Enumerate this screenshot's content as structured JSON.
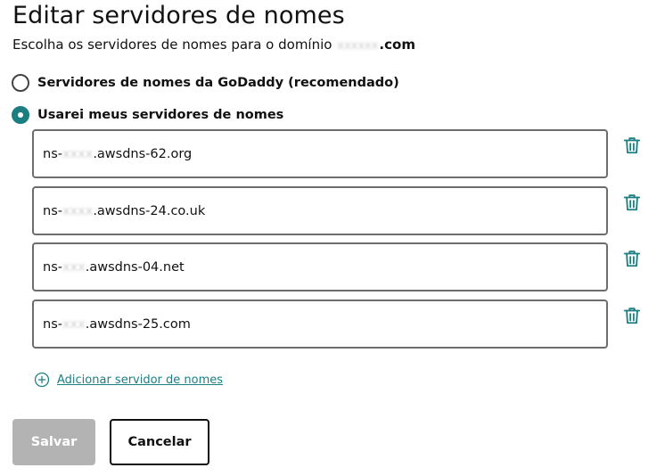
{
  "page": {
    "title": "Editar servidores de nomes",
    "subtitle_prefix": "Escolha os servidores de nomes para o domínio",
    "domain_masked": "xxxxxx",
    "domain_tld": ".com"
  },
  "options": [
    {
      "label": "Servidores de nomes da GoDaddy (recomendado)",
      "checked": false
    },
    {
      "label": "Usarei meus servidores de nomes",
      "checked": true
    }
  ],
  "nameservers": [
    {
      "prefix": "ns-",
      "masked": "xxxx",
      "suffix": ".awsdns-62.org"
    },
    {
      "prefix": "ns-",
      "masked": "xxxx",
      "suffix": ".awsdns-24.co.uk"
    },
    {
      "prefix": "ns-",
      "masked": "xxx",
      "suffix": ".awsdns-04.net"
    },
    {
      "prefix": "ns-",
      "masked": "xxx",
      "suffix": ".awsdns-25.com"
    }
  ],
  "add_link": {
    "label": "Adicionar servidor de nomes"
  },
  "buttons": {
    "save": "Salvar",
    "cancel": "Cancelar"
  },
  "icons": {
    "delete": "trash-icon",
    "add": "plus-circle-icon"
  },
  "colors": {
    "accent": "#1b7e81",
    "disabled": "#b3b3b3",
    "border": "#6d6d6d",
    "text": "#111111"
  }
}
